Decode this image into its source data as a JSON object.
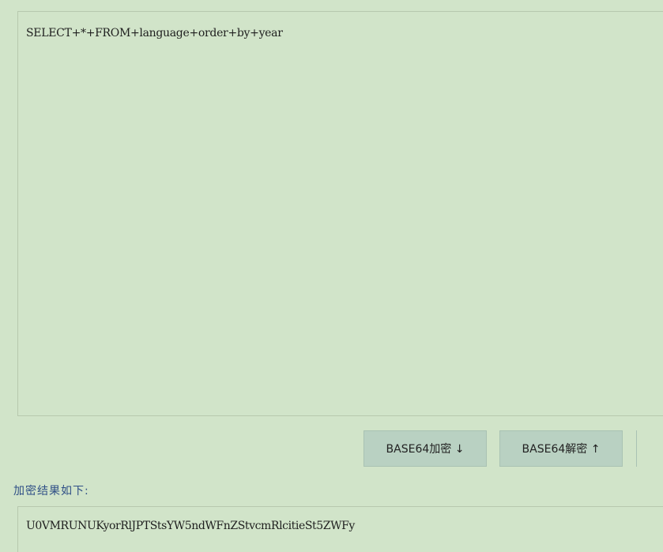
{
  "input": {
    "value": "SELECT+*+FROM+language+order+by+year"
  },
  "buttons": {
    "encode_label": "BASE64加密 ↓",
    "decode_label": "BASE64解密 ↑"
  },
  "result": {
    "label": "加密结果如下:",
    "value": "U0VMRUNUKyorRlJPTStsYW5ndWFnZStvcmRlcitieSt5ZWFy"
  },
  "colors": {
    "background": "#d1e4c9",
    "button_bg": "#b9d1c2",
    "label_text": "#2f4f86"
  }
}
